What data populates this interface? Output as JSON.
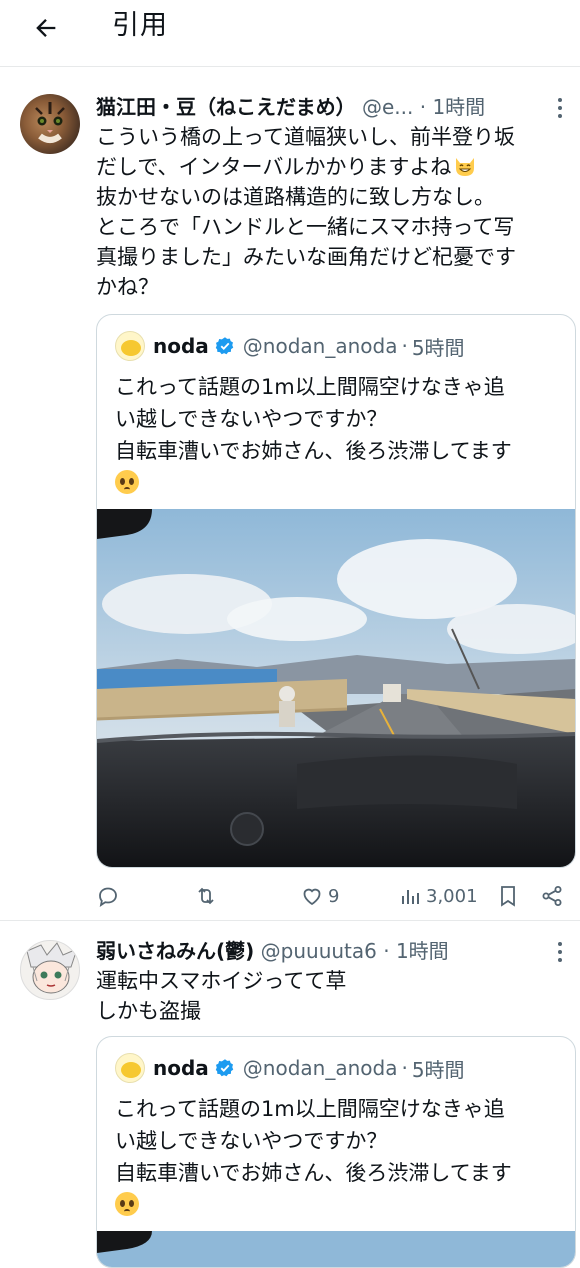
{
  "header": {
    "title": "引用"
  },
  "posts": [
    {
      "name": "猫江田・豆（ねこえだまめ）",
      "handle": "@e...",
      "dot": "·",
      "time": "1時間",
      "lines": [
        "こういう橋の上って道幅狭いし、前半登り坂",
        "だしで、インターバルかかりますよね",
        "抜かせないのは道路構造的に致し方なし。",
        "ところで「ハンドルと一緒にスマホ持って写",
        "真撮りました」みたいな画角だけど杞憂です",
        "かね？"
      ],
      "quote": {
        "name": "noda",
        "handle": "@nodan_anoda",
        "dot": "·",
        "time": "5時間",
        "lines": [
          "これって話題の1m以上間隔空けなきゃ追",
          "い越しできないやつですか？",
          "自転車漕いでお姉さん、後ろ渋滞してます"
        ]
      },
      "actions": {
        "replies": "",
        "retweets": "",
        "likes": "9",
        "views": "3,001"
      }
    },
    {
      "name": "弱いさねみん(鬱)",
      "handle": "@puuuuta6",
      "dot": "·",
      "time": "1時間",
      "lines": [
        "運転中スマホイジってて草",
        "しかも盗撮"
      ],
      "quote": {
        "name": "noda",
        "handle": "@nodan_anoda",
        "dot": "·",
        "time": "5時間",
        "lines": [
          "これって話題の1m以上間隔空けなきゃ追",
          "い越しできないやつですか？",
          "自転車漕いでお姉さん、後ろ渋滞してます"
        ]
      }
    }
  ],
  "icons": {
    "back": "back-arrow-icon",
    "verified": "verified-badge-icon",
    "reply": "reply-icon",
    "retweet": "retweet-icon",
    "like": "heart-icon",
    "views": "views-chart-icon",
    "bookmark": "bookmark-icon",
    "share": "share-icon"
  },
  "colors": {
    "accent": "#1d9bf0",
    "secondary": "#536471",
    "border": "#cfd9de"
  }
}
